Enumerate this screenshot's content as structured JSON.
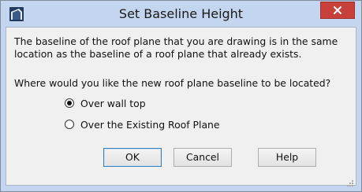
{
  "window": {
    "title": "Set Baseline Height",
    "app_icon": "roof-app-icon",
    "close_icon": "close-icon",
    "close_color": "#c7413a"
  },
  "content": {
    "message_line1": "The baseline of the roof plane that you are drawing is in the same",
    "message_line2": "location as the baseline of a roof plane that already exists.",
    "question": "Where would you like the new roof plane baseline to be located?",
    "options": [
      {
        "label": "Over wall top",
        "selected": true
      },
      {
        "label": "Over the Existing Roof Plane",
        "selected": false
      }
    ]
  },
  "buttons": {
    "ok": "OK",
    "cancel": "Cancel",
    "help": "Help"
  }
}
